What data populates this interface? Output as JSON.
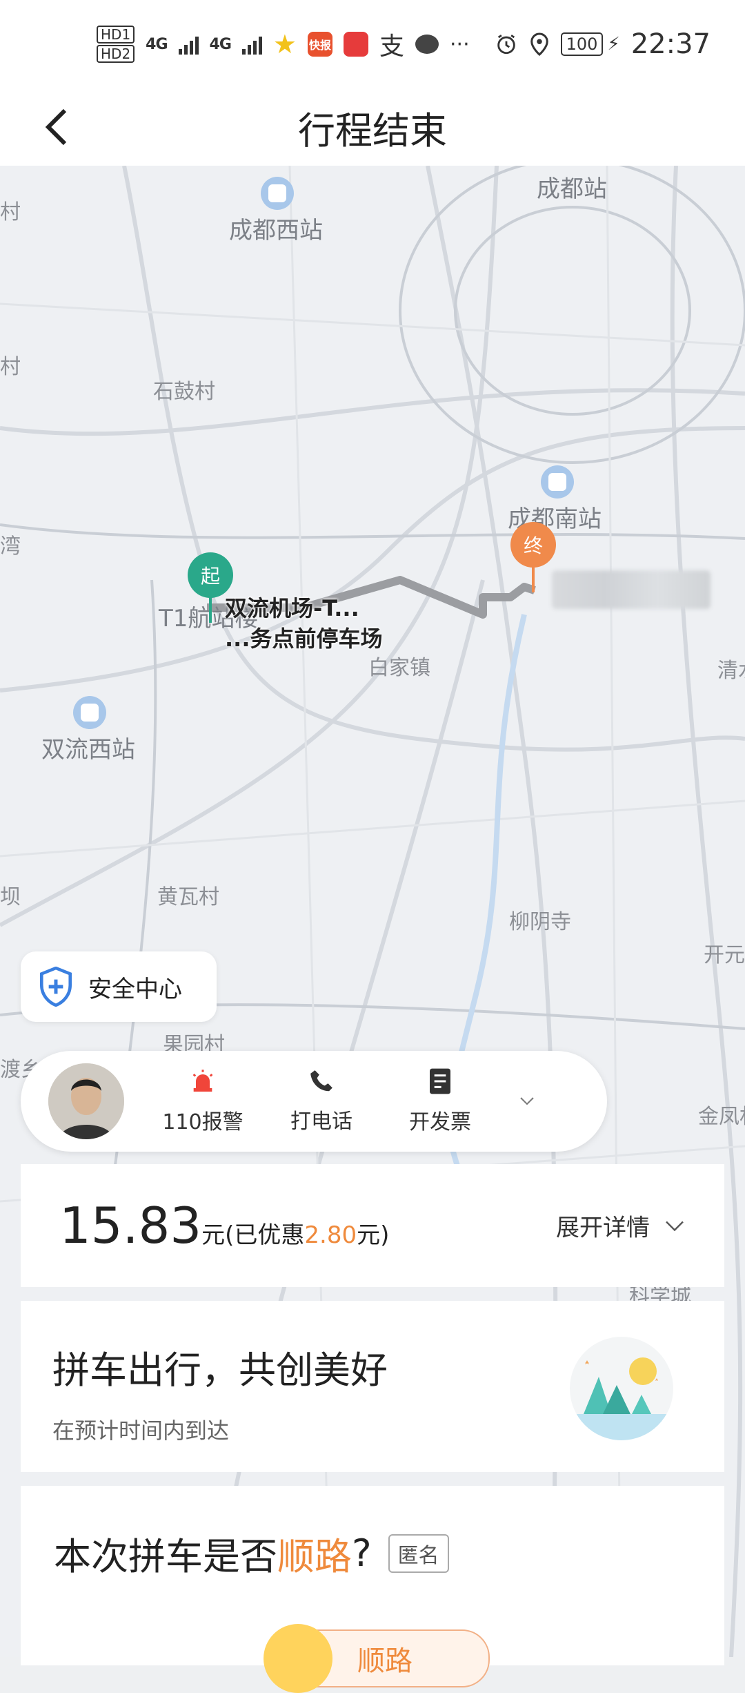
{
  "status_bar": {
    "hd1": "HD1",
    "hd2": "HD2",
    "net1": "4G",
    "net2": "4G",
    "app_kuaibao": "快报",
    "alipay_glyph": "支",
    "more": "···",
    "battery": "100",
    "time": "22:37"
  },
  "header": {
    "title": "行程结束"
  },
  "map": {
    "labels": {
      "chengdu_station": "成都站",
      "chengdu_west": "成都西站",
      "shigu": "石鼓村",
      "chengdu_south": "成都南站",
      "t1": "T1航站楼",
      "baijia": "白家镇",
      "shuangliu_west": "双流西站",
      "huangwa": "黄瓦村",
      "liuyin": "柳阴寺",
      "guoyuan": "果园村",
      "qingshui": "清水",
      "kaiyuan": "开元",
      "jinfeng": "金凤村",
      "left_cun1": "村",
      "left_cun2": "村",
      "left_wan": "湾",
      "left_ba": "坝",
      "left_du": "渡乡",
      "kexuecheng": "科学城"
    },
    "start": {
      "marker": "起",
      "label_line1": "双流机场-T...",
      "label_line2": "...务点前停车场"
    },
    "end": {
      "marker": "终"
    }
  },
  "safety": {
    "label": "安全中心"
  },
  "actions": {
    "police": "110报警",
    "call": "打电话",
    "invoice": "开发票"
  },
  "fare": {
    "amount": "15.83",
    "unit_prefix": "元(已优惠",
    "discount": "2.80",
    "unit_suffix": "元)",
    "expand": "展开详情"
  },
  "promo": {
    "headline": "拼车出行，共创美好",
    "subtitle": "在预计时间内到达"
  },
  "survey": {
    "question_prefix": "本次拼车是否",
    "question_highlight": "顺路",
    "question_suffix": "?",
    "anonymous": "匿名",
    "answer": "顺路"
  },
  "colors": {
    "accent_orange": "#ef8a3c",
    "start_green": "#2aa88a",
    "end_orange": "#f08a4b",
    "map_bg": "#eef0f3"
  }
}
